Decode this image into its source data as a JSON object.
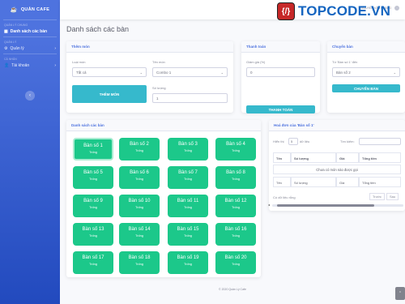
{
  "sidebar": {
    "brand": "QUẢN CAFE",
    "brand_icon": "coffee-icon",
    "sections": [
      {
        "heading": "QUẢN LÝ CHUNG",
        "item": "Danh sách các bàn",
        "icon": "table-icon"
      },
      {
        "heading": "QUẢN LÝ",
        "item": "Quản lý",
        "icon": "gear-icon"
      },
      {
        "heading": "CÁ NHÂN",
        "item": "Tài khoản",
        "icon": "user-icon"
      }
    ],
    "toggle": "‹"
  },
  "topbar": {
    "username": "NGUYỄN VĂN HOÀNG"
  },
  "watermark": {
    "box": "{/}",
    "text": "TOPCODE.VN"
  },
  "page_title": "Danh sách các bàn",
  "add_dish": {
    "title": "Thêm món",
    "category_label": "Loại món",
    "category_value": "Tất cả",
    "dish_label": "Tên món",
    "dish_value": "Combo 1",
    "qty_label": "Số lượng",
    "qty_value": "1",
    "button": "THÊM MÓN"
  },
  "payment": {
    "title": "Thanh toán",
    "discount_label": "Giảm giá (%)",
    "discount_value": "0",
    "button": "THANH TOÁN"
  },
  "move": {
    "title": "Chuyển bàn",
    "from_label": "Từ 'Bàn số 1' đến",
    "to_value": "Bàn số 2",
    "button": "CHUYỂN BÀN"
  },
  "tables_card": {
    "title": "Danh sách các bàn",
    "status": "Trống",
    "tables": [
      "Bàn số 1",
      "Bàn số 2",
      "Bàn số 3",
      "Bàn số 4",
      "Bàn số 5",
      "Bàn số 6",
      "Bàn số 7",
      "Bàn số 8",
      "Bàn số 9",
      "Bàn số 10",
      "Bàn số 11",
      "Bàn số 12",
      "Bàn số 13",
      "Bàn số 14",
      "Bàn số 15",
      "Bàn số 16",
      "Bàn số 17",
      "Bàn số 18",
      "Bàn số 19",
      "Bàn số 20"
    ]
  },
  "invoice": {
    "title": "Hoá đơn của 'Bàn số 1'",
    "show_label": "Hiển thị",
    "show_value": "5",
    "records_label": "dữ liệu",
    "search_label": "Tìm kiếm:",
    "columns": [
      "Tên",
      "Số lượng",
      "Giá",
      "Tổng tiền"
    ],
    "empty": "Chưa có món nào được gọi",
    "empty_info": "Có dữ liệu rỗng",
    "prev": "Trước",
    "next": "Sau"
  },
  "footer": "© 2020 Quản Lý Cafe",
  "colors": {
    "primary": "#4e73df",
    "success": "#1cc88a",
    "info": "#36b9cc"
  }
}
